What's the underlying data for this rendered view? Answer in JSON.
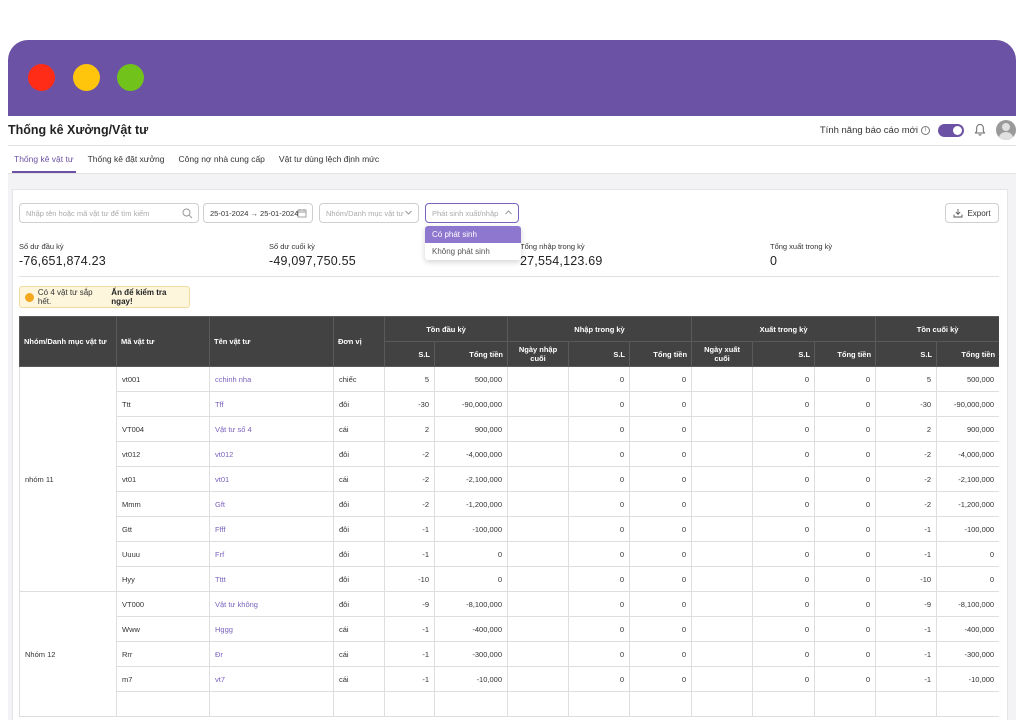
{
  "header": {
    "title": "Thống kê Xưởng/Vật tư",
    "new_feature_label": "Tính năng báo cáo mới"
  },
  "tabs": [
    {
      "label": "Thống kê vật tư",
      "active": true
    },
    {
      "label": "Thống kê đặt xưởng",
      "active": false
    },
    {
      "label": "Công nợ nhà cung cấp",
      "active": false
    },
    {
      "label": "Vật tư dùng lệch định mức",
      "active": false
    }
  ],
  "filters": {
    "search_placeholder": "Nhập tên hoặc mã vật tư để tìm kiếm",
    "date_range": "25-01-2024 → 25-01-2024",
    "group_placeholder": "Nhóm/Danh mục vật tư",
    "status_placeholder": "Phát sinh xuất/nhập",
    "export_label": "Export"
  },
  "status_options": [
    {
      "label": "Có phát sinh",
      "selected": true
    },
    {
      "label": "Không phát sinh",
      "selected": false
    }
  ],
  "summary": [
    {
      "label": "Số dư đầu kỳ",
      "value": "-76,651,874.23"
    },
    {
      "label": "Số dư cuối kỳ",
      "value": "-49,097,750.55"
    },
    {
      "label": "Tổng nhập trong kỳ",
      "value": "27,554,123.69"
    },
    {
      "label": "Tổng xuất trong kỳ",
      "value": "0"
    }
  ],
  "alert": {
    "text": "Có 4 vật tư sắp hết.",
    "action": "Ấn để kiểm tra ngay!"
  },
  "table": {
    "headers": {
      "group": "Nhóm/Danh mục vật tư",
      "code": "Mã vật tư",
      "name": "Tên vật tư",
      "unit": "Đơn vị",
      "opening": "Tồn đầu kỳ",
      "import": "Nhập trong kỳ",
      "export": "Xuất trong kỳ",
      "closing": "Tồn cuối kỳ",
      "qty": "S.L",
      "amount": "Tổng tiền",
      "last_import": "Ngày nhập cuối",
      "last_export": "Ngày xuất cuối"
    },
    "groups": [
      {
        "name": "nhóm 11",
        "rows": [
          {
            "code": "vt001",
            "name": "cchinh nha",
            "unit": "chiếc",
            "open_qty": "5",
            "open_amt": "500,000",
            "imp_date": "",
            "imp_qty": "0",
            "imp_amt": "0",
            "exp_date": "",
            "exp_qty": "0",
            "exp_amt": "0",
            "close_qty": "5",
            "close_amt": "500,000"
          },
          {
            "code": "Ttt",
            "name": "Tff",
            "unit": "đôi",
            "open_qty": "-30",
            "open_amt": "-90,000,000",
            "imp_date": "",
            "imp_qty": "0",
            "imp_amt": "0",
            "exp_date": "",
            "exp_qty": "0",
            "exp_amt": "0",
            "close_qty": "-30",
            "close_amt": "-90,000,000"
          },
          {
            "code": "VT004",
            "name": "Vật tư số 4",
            "unit": "cái",
            "open_qty": "2",
            "open_amt": "900,000",
            "imp_date": "",
            "imp_qty": "0",
            "imp_amt": "0",
            "exp_date": "",
            "exp_qty": "0",
            "exp_amt": "0",
            "close_qty": "2",
            "close_amt": "900,000"
          },
          {
            "code": "vt012",
            "name": "vt012",
            "unit": "đôi",
            "open_qty": "-2",
            "open_amt": "-4,000,000",
            "imp_date": "",
            "imp_qty": "0",
            "imp_amt": "0",
            "exp_date": "",
            "exp_qty": "0",
            "exp_amt": "0",
            "close_qty": "-2",
            "close_amt": "-4,000,000"
          },
          {
            "code": "vt01",
            "name": "vt01",
            "unit": "cái",
            "open_qty": "-2",
            "open_amt": "-2,100,000",
            "imp_date": "",
            "imp_qty": "0",
            "imp_amt": "0",
            "exp_date": "",
            "exp_qty": "0",
            "exp_amt": "0",
            "close_qty": "-2",
            "close_amt": "-2,100,000"
          },
          {
            "code": "Mmm",
            "name": "Gft",
            "unit": "đôi",
            "open_qty": "-2",
            "open_amt": "-1,200,000",
            "imp_date": "",
            "imp_qty": "0",
            "imp_amt": "0",
            "exp_date": "",
            "exp_qty": "0",
            "exp_amt": "0",
            "close_qty": "-2",
            "close_amt": "-1,200,000"
          },
          {
            "code": "Gtt",
            "name": "Ffff",
            "unit": "đôi",
            "open_qty": "-1",
            "open_amt": "-100,000",
            "imp_date": "",
            "imp_qty": "0",
            "imp_amt": "0",
            "exp_date": "",
            "exp_qty": "0",
            "exp_amt": "0",
            "close_qty": "-1",
            "close_amt": "-100,000"
          },
          {
            "code": "Uuuu",
            "name": "Frf",
            "unit": "đôi",
            "open_qty": "-1",
            "open_amt": "0",
            "imp_date": "",
            "imp_qty": "0",
            "imp_amt": "0",
            "exp_date": "",
            "exp_qty": "0",
            "exp_amt": "0",
            "close_qty": "-1",
            "close_amt": "0"
          },
          {
            "code": "Hyy",
            "name": "Tttt",
            "unit": "đôi",
            "open_qty": "-10",
            "open_amt": "0",
            "imp_date": "",
            "imp_qty": "0",
            "imp_amt": "0",
            "exp_date": "",
            "exp_qty": "0",
            "exp_amt": "0",
            "close_qty": "-10",
            "close_amt": "0"
          }
        ]
      },
      {
        "name": "Nhóm 12",
        "rows": [
          {
            "code": "VT000",
            "name": "Vật tư không",
            "unit": "đôi",
            "open_qty": "-9",
            "open_amt": "-8,100,000",
            "imp_date": "",
            "imp_qty": "0",
            "imp_amt": "0",
            "exp_date": "",
            "exp_qty": "0",
            "exp_amt": "0",
            "close_qty": "-9",
            "close_amt": "-8,100,000"
          },
          {
            "code": "Www",
            "name": "Hggg",
            "unit": "cái",
            "open_qty": "-1",
            "open_amt": "-400,000",
            "imp_date": "",
            "imp_qty": "0",
            "imp_amt": "0",
            "exp_date": "",
            "exp_qty": "0",
            "exp_amt": "0",
            "close_qty": "-1",
            "close_amt": "-400,000"
          },
          {
            "code": "Rrr",
            "name": "Đr",
            "unit": "cái",
            "open_qty": "-1",
            "open_amt": "-300,000",
            "imp_date": "",
            "imp_qty": "0",
            "imp_amt": "0",
            "exp_date": "",
            "exp_qty": "0",
            "exp_amt": "0",
            "close_qty": "-1",
            "close_amt": "-300,000"
          },
          {
            "code": "m7",
            "name": "vt7",
            "unit": "cái",
            "open_qty": "-1",
            "open_amt": "-10,000",
            "imp_date": "",
            "imp_qty": "0",
            "imp_amt": "0",
            "exp_date": "",
            "exp_qty": "0",
            "exp_amt": "0",
            "close_qty": "-1",
            "close_amt": "-10,000"
          },
          {
            "code": "",
            "name": "",
            "unit": "",
            "open_qty": "",
            "open_amt": "",
            "imp_date": "",
            "imp_qty": "",
            "imp_amt": "",
            "exp_date": "",
            "exp_qty": "",
            "exp_amt": "",
            "close_qty": "",
            "close_amt": ""
          }
        ]
      }
    ]
  },
  "colors": {
    "brand": "#6c52a5",
    "header_bg": "#424242",
    "link": "#7a62bd",
    "warning": "#f4a81d"
  }
}
